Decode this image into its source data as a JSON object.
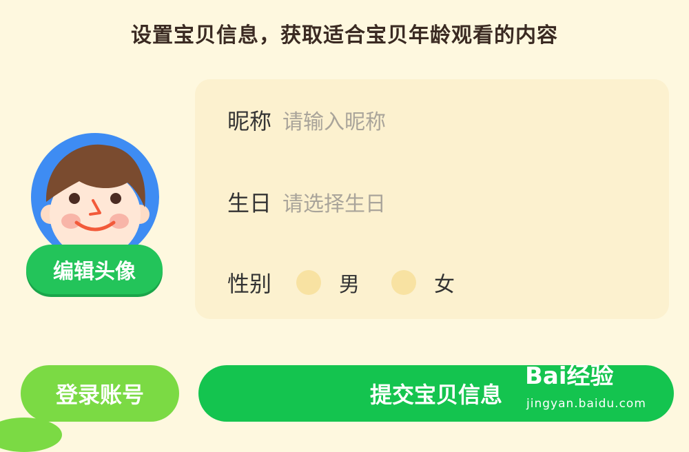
{
  "header": {
    "title": "设置宝贝信息，获取适合宝贝年龄观看的内容"
  },
  "avatar": {
    "edit_label": "编辑头像"
  },
  "form": {
    "nickname": {
      "label": "昵称",
      "placeholder": "请输入昵称"
    },
    "birthday": {
      "label": "生日",
      "placeholder": "请选择生日"
    },
    "gender": {
      "label": "性别",
      "options": [
        "男",
        "女"
      ]
    }
  },
  "actions": {
    "login_label": "登录账号",
    "submit_label": "提交宝贝信息"
  },
  "watermark": {
    "logo": "Bai经验",
    "url": "jingyan.baidu.com"
  },
  "colors": {
    "background": "#FEF8DF",
    "panel": "#FCF1CF",
    "primary_green": "#14C44F",
    "light_green": "#7BDA44",
    "avatar_ring": "#3E8CF3"
  }
}
